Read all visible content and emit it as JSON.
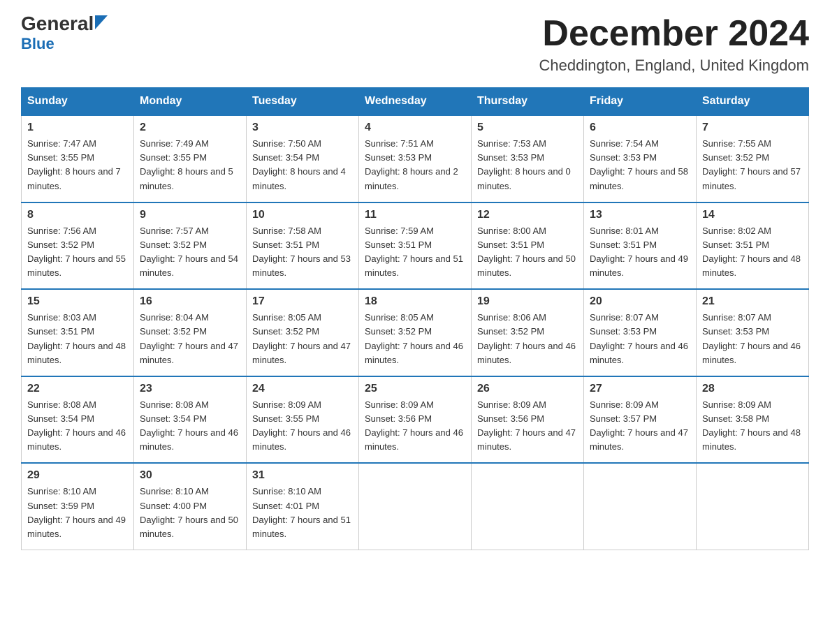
{
  "header": {
    "logo_general": "General",
    "logo_blue": "Blue",
    "month_title": "December 2024",
    "location": "Cheddington, England, United Kingdom"
  },
  "days_of_week": [
    "Sunday",
    "Monday",
    "Tuesday",
    "Wednesday",
    "Thursday",
    "Friday",
    "Saturday"
  ],
  "weeks": [
    [
      {
        "num": "1",
        "sunrise": "7:47 AM",
        "sunset": "3:55 PM",
        "daylight": "8 hours and 7 minutes."
      },
      {
        "num": "2",
        "sunrise": "7:49 AM",
        "sunset": "3:55 PM",
        "daylight": "8 hours and 5 minutes."
      },
      {
        "num": "3",
        "sunrise": "7:50 AM",
        "sunset": "3:54 PM",
        "daylight": "8 hours and 4 minutes."
      },
      {
        "num": "4",
        "sunrise": "7:51 AM",
        "sunset": "3:53 PM",
        "daylight": "8 hours and 2 minutes."
      },
      {
        "num": "5",
        "sunrise": "7:53 AM",
        "sunset": "3:53 PM",
        "daylight": "8 hours and 0 minutes."
      },
      {
        "num": "6",
        "sunrise": "7:54 AM",
        "sunset": "3:53 PM",
        "daylight": "7 hours and 58 minutes."
      },
      {
        "num": "7",
        "sunrise": "7:55 AM",
        "sunset": "3:52 PM",
        "daylight": "7 hours and 57 minutes."
      }
    ],
    [
      {
        "num": "8",
        "sunrise": "7:56 AM",
        "sunset": "3:52 PM",
        "daylight": "7 hours and 55 minutes."
      },
      {
        "num": "9",
        "sunrise": "7:57 AM",
        "sunset": "3:52 PM",
        "daylight": "7 hours and 54 minutes."
      },
      {
        "num": "10",
        "sunrise": "7:58 AM",
        "sunset": "3:51 PM",
        "daylight": "7 hours and 53 minutes."
      },
      {
        "num": "11",
        "sunrise": "7:59 AM",
        "sunset": "3:51 PM",
        "daylight": "7 hours and 51 minutes."
      },
      {
        "num": "12",
        "sunrise": "8:00 AM",
        "sunset": "3:51 PM",
        "daylight": "7 hours and 50 minutes."
      },
      {
        "num": "13",
        "sunrise": "8:01 AM",
        "sunset": "3:51 PM",
        "daylight": "7 hours and 49 minutes."
      },
      {
        "num": "14",
        "sunrise": "8:02 AM",
        "sunset": "3:51 PM",
        "daylight": "7 hours and 48 minutes."
      }
    ],
    [
      {
        "num": "15",
        "sunrise": "8:03 AM",
        "sunset": "3:51 PM",
        "daylight": "7 hours and 48 minutes."
      },
      {
        "num": "16",
        "sunrise": "8:04 AM",
        "sunset": "3:52 PM",
        "daylight": "7 hours and 47 minutes."
      },
      {
        "num": "17",
        "sunrise": "8:05 AM",
        "sunset": "3:52 PM",
        "daylight": "7 hours and 47 minutes."
      },
      {
        "num": "18",
        "sunrise": "8:05 AM",
        "sunset": "3:52 PM",
        "daylight": "7 hours and 46 minutes."
      },
      {
        "num": "19",
        "sunrise": "8:06 AM",
        "sunset": "3:52 PM",
        "daylight": "7 hours and 46 minutes."
      },
      {
        "num": "20",
        "sunrise": "8:07 AM",
        "sunset": "3:53 PM",
        "daylight": "7 hours and 46 minutes."
      },
      {
        "num": "21",
        "sunrise": "8:07 AM",
        "sunset": "3:53 PM",
        "daylight": "7 hours and 46 minutes."
      }
    ],
    [
      {
        "num": "22",
        "sunrise": "8:08 AM",
        "sunset": "3:54 PM",
        "daylight": "7 hours and 46 minutes."
      },
      {
        "num": "23",
        "sunrise": "8:08 AM",
        "sunset": "3:54 PM",
        "daylight": "7 hours and 46 minutes."
      },
      {
        "num": "24",
        "sunrise": "8:09 AM",
        "sunset": "3:55 PM",
        "daylight": "7 hours and 46 minutes."
      },
      {
        "num": "25",
        "sunrise": "8:09 AM",
        "sunset": "3:56 PM",
        "daylight": "7 hours and 46 minutes."
      },
      {
        "num": "26",
        "sunrise": "8:09 AM",
        "sunset": "3:56 PM",
        "daylight": "7 hours and 47 minutes."
      },
      {
        "num": "27",
        "sunrise": "8:09 AM",
        "sunset": "3:57 PM",
        "daylight": "7 hours and 47 minutes."
      },
      {
        "num": "28",
        "sunrise": "8:09 AM",
        "sunset": "3:58 PM",
        "daylight": "7 hours and 48 minutes."
      }
    ],
    [
      {
        "num": "29",
        "sunrise": "8:10 AM",
        "sunset": "3:59 PM",
        "daylight": "7 hours and 49 minutes."
      },
      {
        "num": "30",
        "sunrise": "8:10 AM",
        "sunset": "4:00 PM",
        "daylight": "7 hours and 50 minutes."
      },
      {
        "num": "31",
        "sunrise": "8:10 AM",
        "sunset": "4:01 PM",
        "daylight": "7 hours and 51 minutes."
      },
      null,
      null,
      null,
      null
    ]
  ]
}
